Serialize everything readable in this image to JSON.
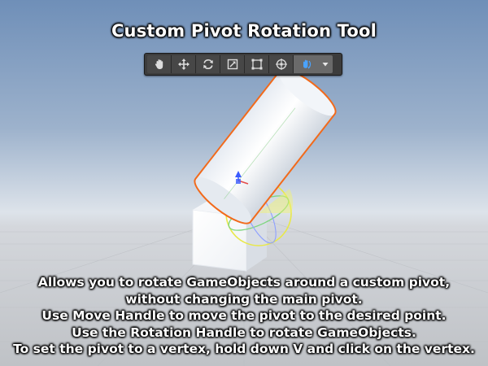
{
  "title": "Custom Pivot Rotation Tool",
  "toolbar": {
    "buttons": [
      {
        "icon": "hand-icon",
        "active": false
      },
      {
        "icon": "move-icon",
        "active": false
      },
      {
        "icon": "rotate-icon",
        "active": false
      },
      {
        "icon": "scale-icon",
        "active": false
      },
      {
        "icon": "rect-icon",
        "active": false
      },
      {
        "icon": "transform-icon",
        "active": false
      },
      {
        "icon": "custom-pivot-icon",
        "active": true
      }
    ],
    "dropdown_icon": "chevron-down-icon"
  },
  "description": {
    "lines": [
      "Allows you to rotate GameObjects around a custom pivot,",
      "without changing the main pivot.",
      "Use Move Handle to move the pivot to the desired point.",
      "Use the Rotation Handle to rotate GameObjects.",
      "To set the pivot to a vertex, hold down V and click on the vertex."
    ]
  },
  "colors": {
    "sky_top": "#6e8fb8",
    "horizon": "#dbe2ea",
    "ground": "#c9ccd0",
    "selection_outline": "#f26a1b",
    "gizmo_yellow": "#e8e84a",
    "gizmo_green": "#7ed67e",
    "gizmo_blue": "#3b5bff",
    "toolbar_bg": "#3c3c3c"
  }
}
